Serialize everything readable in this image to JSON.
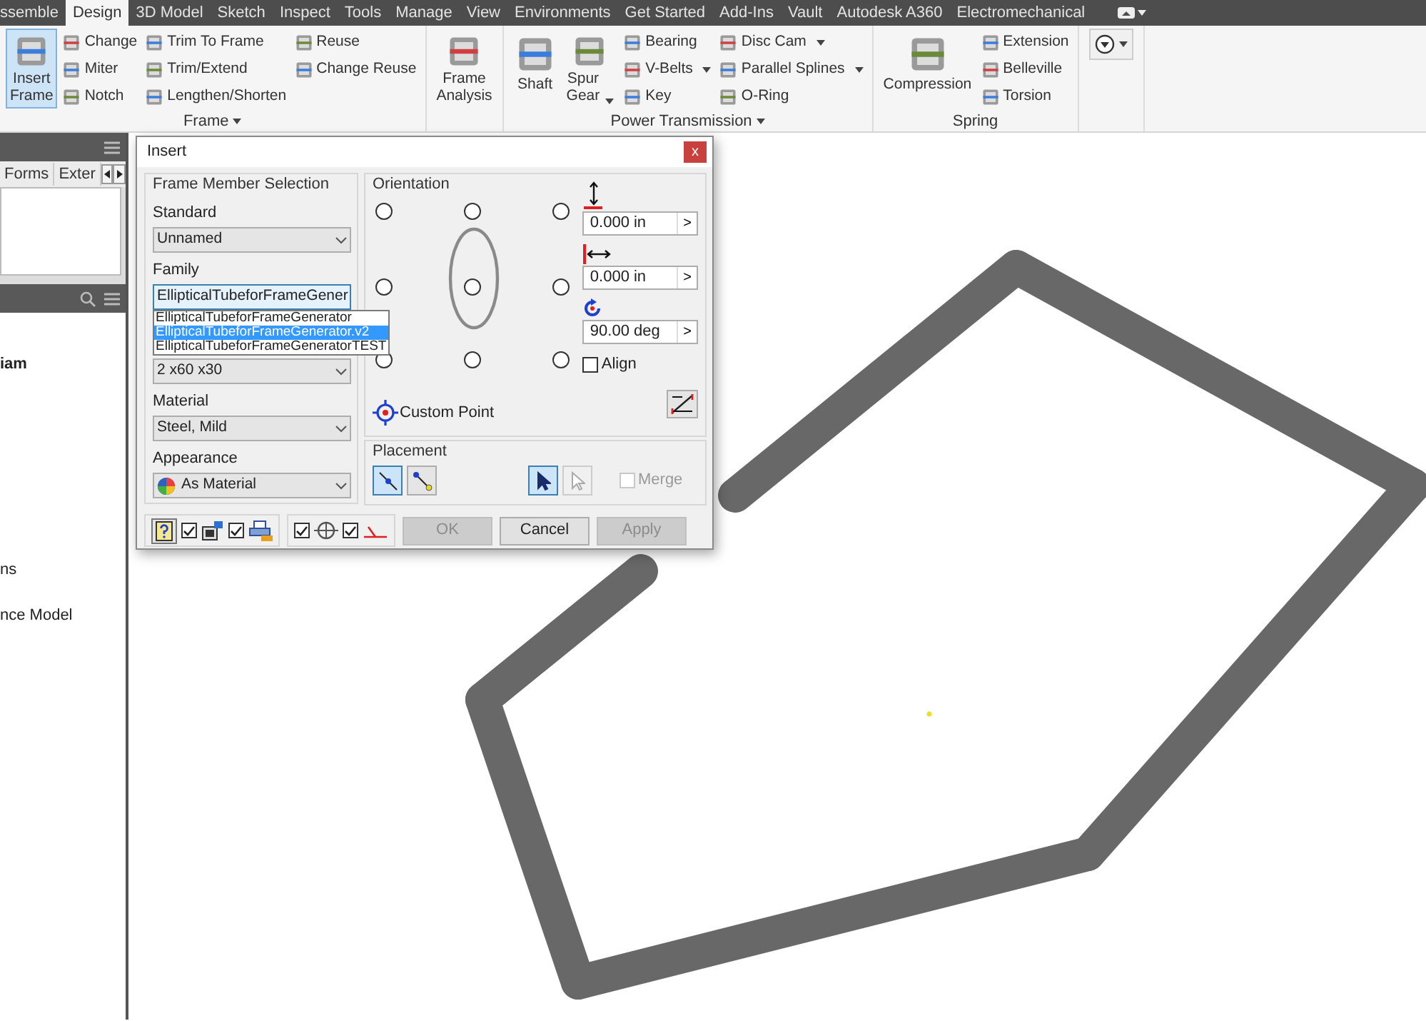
{
  "menu_tabs": [
    {
      "label": "ssemble",
      "selected": false
    },
    {
      "label": "Design",
      "selected": true
    },
    {
      "label": "3D Model",
      "selected": false
    },
    {
      "label": "Sketch",
      "selected": false
    },
    {
      "label": "Inspect",
      "selected": false
    },
    {
      "label": "Tools",
      "selected": false
    },
    {
      "label": "Manage",
      "selected": false
    },
    {
      "label": "View",
      "selected": false
    },
    {
      "label": "Environments",
      "selected": false
    },
    {
      "label": "Get Started",
      "selected": false
    },
    {
      "label": "Add-Ins",
      "selected": false
    },
    {
      "label": "Vault",
      "selected": false
    },
    {
      "label": "Autodesk A360",
      "selected": false
    },
    {
      "label": "Electromechanical",
      "selected": false
    }
  ],
  "ribbon": {
    "panels": [
      {
        "label": "Frame",
        "menu": true,
        "columns": [
          [
            {
              "lines": [
                "Insert",
                "Frame"
              ],
              "kind": "large",
              "selected": true
            }
          ],
          [
            {
              "label": "Change",
              "kind": "small",
              "selected": false
            },
            {
              "label": "Miter",
              "kind": "small",
              "selected": false
            },
            {
              "label": "Notch",
              "kind": "small",
              "selected": false
            }
          ],
          [
            {
              "label": "Trim To Frame",
              "kind": "small",
              "selected": false
            },
            {
              "label": "Trim/Extend",
              "kind": "small",
              "selected": false
            },
            {
              "label": "Lengthen/Shorten",
              "kind": "small",
              "selected": false
            }
          ],
          [
            {
              "label": "Reuse",
              "kind": "small",
              "selected": false
            },
            {
              "label": "Change Reuse",
              "kind": "small",
              "selected": false
            }
          ]
        ]
      },
      {
        "columns": [
          [
            {
              "lines": [
                "Frame",
                "Analysis"
              ],
              "kind": "large",
              "selected": false
            }
          ]
        ]
      },
      {
        "label": "Power Transmission",
        "menu": true,
        "columns": [
          [
            {
              "lines": [
                "Shaft"
              ],
              "kind": "large",
              "selected": false
            }
          ],
          [
            {
              "lines": [
                "Spur",
                "Gear"
              ],
              "kind": "large",
              "selected": false,
              "dropdown": true
            }
          ],
          [
            {
              "label": "Bearing",
              "kind": "small",
              "selected": false
            },
            {
              "label": "V-Belts",
              "kind": "small",
              "selected": false,
              "dropdown": true
            },
            {
              "label": "Key",
              "kind": "small",
              "selected": false
            }
          ],
          [
            {
              "label": "Disc Cam",
              "kind": "small",
              "selected": false,
              "dropdown": true
            },
            {
              "label": "Parallel Splines",
              "kind": "small",
              "selected": false,
              "dropdown": true
            },
            {
              "label": "O-Ring",
              "kind": "small",
              "selected": false
            }
          ]
        ]
      },
      {
        "label": "Spring",
        "columns": [
          [
            {
              "lines": [
                "Compression"
              ],
              "kind": "large",
              "selected": false
            }
          ],
          [
            {
              "label": "Extension",
              "kind": "small",
              "selected": false
            },
            {
              "label": "Belleville",
              "kind": "small",
              "selected": false
            },
            {
              "label": "Torsion",
              "kind": "small",
              "selected": false
            }
          ]
        ]
      }
    ]
  },
  "browser": {
    "tabs": [
      {
        "label": "Forms",
        "selected": false
      },
      {
        "label": "Exter",
        "selected": false
      }
    ],
    "tree": [
      {
        "label": "iam",
        "kind": "bold"
      },
      {
        "label": "ns",
        "kind": "plain"
      },
      {
        "label": "nce Model",
        "kind": "plain"
      }
    ]
  },
  "dialog": {
    "title": "Insert",
    "close": "x",
    "member_selection": {
      "title": "Frame Member Selection",
      "fields": [
        {
          "label": "Standard",
          "value": "Unnamed",
          "kind": "select"
        },
        {
          "label": "Family",
          "value": "EllipticalTubeforFrameGener",
          "kind": "select",
          "focused": true,
          "open_list": [
            {
              "label": "EllipticalTubeforFrameGenerator",
              "selected": false
            },
            {
              "label": "EllipticalTubeforFrameGenerator.v2",
              "selected": true
            },
            {
              "label": "EllipticalTubeforFrameGeneratorTEST",
              "selected": false
            }
          ]
        },
        {
          "value": "2 x60 x30",
          "kind": "select"
        },
        {
          "label": "Material",
          "value": "Steel, Mild",
          "kind": "select"
        },
        {
          "label": "Appearance",
          "value": "As Material",
          "kind": "appearance"
        }
      ]
    },
    "orientation": {
      "title": "Orientation",
      "anchors": [
        {
          "selected": false
        },
        {
          "selected": false
        },
        {
          "selected": false
        },
        {
          "selected": false
        },
        {
          "selected": false
        },
        {
          "selected": false
        },
        {
          "selected": false
        },
        {
          "selected": false
        },
        {
          "selected": false
        }
      ],
      "offsets": [
        {
          "kind": "vertical",
          "value": "0.000 in",
          "button": ">"
        },
        {
          "kind": "horizontal",
          "value": "0.000 in",
          "button": ">"
        },
        {
          "kind": "angle",
          "value": "90.00 deg",
          "button": ">"
        }
      ],
      "align": {
        "label": "Align",
        "checked": false
      },
      "custom_point": "Custom Point"
    },
    "placement": {
      "title": "Placement",
      "modes": [
        {
          "selected": true
        },
        {
          "selected": false
        }
      ],
      "select_tools": [
        {
          "selected": true,
          "disabled": false
        },
        {
          "selected": false,
          "disabled": true
        }
      ],
      "merge": {
        "label": "Merge",
        "checked": false,
        "disabled": true
      }
    },
    "options": [
      {
        "checked": true
      },
      {
        "checked": true
      },
      {
        "checked": true
      },
      {
        "checked": true
      }
    ],
    "buttons": [
      {
        "label": "OK",
        "disabled": true
      },
      {
        "label": "Cancel",
        "disabled": false
      },
      {
        "label": "Apply",
        "disabled": true
      }
    ]
  }
}
